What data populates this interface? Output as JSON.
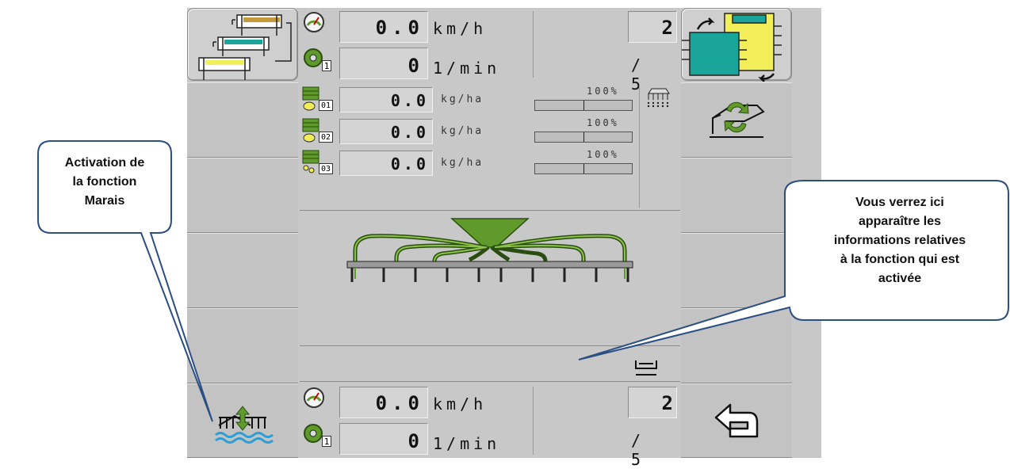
{
  "top_status": {
    "speed_value": "0.0",
    "speed_unit": "km/h",
    "rpm_index": "1",
    "rpm_value": "0",
    "rpm_unit": "1/min",
    "page_current": "2",
    "page_total": "/ 5"
  },
  "bottom_status": {
    "speed_value": "0.0",
    "speed_unit": "km/h",
    "rpm_index": "1",
    "rpm_value": "0",
    "rpm_unit": "1/min",
    "page_current": "2",
    "page_total": "/ 5"
  },
  "metering_rows": [
    {
      "index": "01",
      "value": "0.0",
      "unit": "kg/ha",
      "percent_label": "100%",
      "level": 1.0
    },
    {
      "index": "02",
      "value": "0.0",
      "unit": "kg/ha",
      "percent_label": "100%",
      "level": 1.0
    },
    {
      "index": "03",
      "value": "0.0",
      "unit": "kg/ha",
      "percent_label": "100%",
      "level": 1.0
    }
  ],
  "callouts": {
    "left_line1": "Activation de",
    "left_line2": "la fonction",
    "left_line3": "Marais",
    "right_line1": "Vous verrez ici",
    "right_line2": "apparaître les",
    "right_line3": "informations relatives",
    "right_line4": "à la fonction qui est",
    "right_line5": "activée"
  },
  "icons": {
    "top_left_softkey": "layout-switch-icon",
    "top_right_softkey": "screen-layout-icon",
    "right_softkey_1": "refresh-implement-icon",
    "left_softkey_bottom": "marsh-function-icon",
    "right_softkey_bottom": "back-arrow-icon"
  },
  "colors": {
    "screen_bg": "#c8c8c8",
    "implement_green": "#5f9a2a",
    "marsh_blue": "#2a9fd6",
    "accent_yellow": "#f2ee5a",
    "accent_teal": "#1aa59a"
  }
}
